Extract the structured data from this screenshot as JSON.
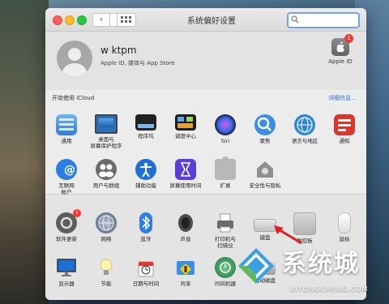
{
  "window": {
    "title": "系统偏好设置",
    "search_placeholder": ""
  },
  "account": {
    "name": "w ktpm",
    "subtitle": "Apple ID, 媒体与 App Store",
    "apple_id_label": "Apple ID",
    "apple_id_badge": "1"
  },
  "icloud": {
    "prompt": "开始使用 iCloud",
    "details_link": "详细信息..."
  },
  "section1": [
    {
      "label": "通用",
      "icon": "general-icon"
    },
    {
      "label": "桌面与\n屏幕保护程序",
      "icon": "desktop-icon"
    },
    {
      "label": "程序坞",
      "icon": "dock-icon"
    },
    {
      "label": "调度中心",
      "icon": "mission-control-icon"
    },
    {
      "label": "Siri",
      "icon": "siri-icon"
    },
    {
      "label": "聚焦",
      "icon": "spotlight-icon"
    },
    {
      "label": "语言与地区",
      "icon": "language-icon"
    },
    {
      "label": "通知",
      "icon": "notifications-icon"
    },
    {
      "label": "互联网\n帐户",
      "icon": "internet-accounts-icon"
    },
    {
      "label": "用户与群组",
      "icon": "users-icon"
    },
    {
      "label": "辅助功能",
      "icon": "accessibility-icon"
    },
    {
      "label": "屏幕使用时间",
      "icon": "screen-time-icon"
    },
    {
      "label": "扩展",
      "icon": "extensions-icon"
    },
    {
      "label": "安全性与隐私",
      "icon": "security-icon"
    }
  ],
  "section2": [
    {
      "label": "软件更新",
      "icon": "software-update-icon",
      "badge": "1"
    },
    {
      "label": "网络",
      "icon": "network-icon"
    },
    {
      "label": "蓝牙",
      "icon": "bluetooth-icon"
    },
    {
      "label": "声音",
      "icon": "sound-icon"
    },
    {
      "label": "打印机与\n扫描仪",
      "icon": "printer-icon"
    },
    {
      "label": "键盘",
      "icon": "keyboard-icon"
    },
    {
      "label": "触控板",
      "icon": "trackpad-icon"
    },
    {
      "label": "鼠标",
      "icon": "mouse-icon"
    },
    {
      "label": "显示器",
      "icon": "display-icon"
    },
    {
      "label": "节能",
      "icon": "energy-saver-icon"
    },
    {
      "label": "日期与时间",
      "icon": "date-time-icon"
    },
    {
      "label": "共享",
      "icon": "sharing-icon"
    },
    {
      "label": "时间机器",
      "icon": "time-machine-icon"
    },
    {
      "label": "启动磁盘",
      "icon": "startup-disk-icon"
    }
  ],
  "watermark": {
    "brand": "系统城",
    "url": "XITONGCHENG.COM"
  }
}
